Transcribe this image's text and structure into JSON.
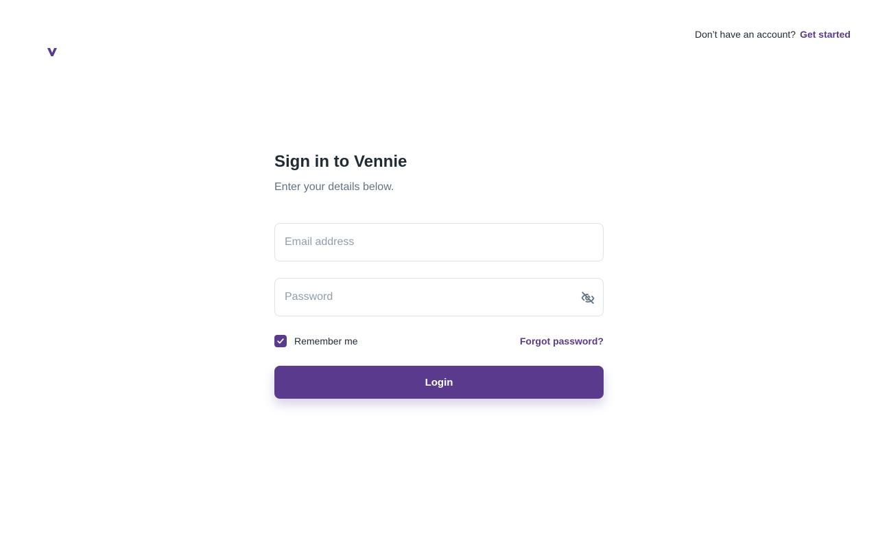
{
  "brand": {
    "logo_icon": "vennie-v-logo-icon",
    "accent_color": "#5a3a8c"
  },
  "topbar": {
    "prompt": "Don’t have an account?",
    "cta": "Get started"
  },
  "form": {
    "title": "Sign in to Vennie",
    "subtitle": "Enter your details below.",
    "email": {
      "placeholder": "Email address",
      "value": ""
    },
    "password": {
      "placeholder": "Password",
      "value": "",
      "toggle_icon": "eye-off-icon"
    },
    "remember": {
      "label": "Remember me",
      "checked": true
    },
    "forgot_label": "Forgot password?",
    "login_label": "Login"
  }
}
